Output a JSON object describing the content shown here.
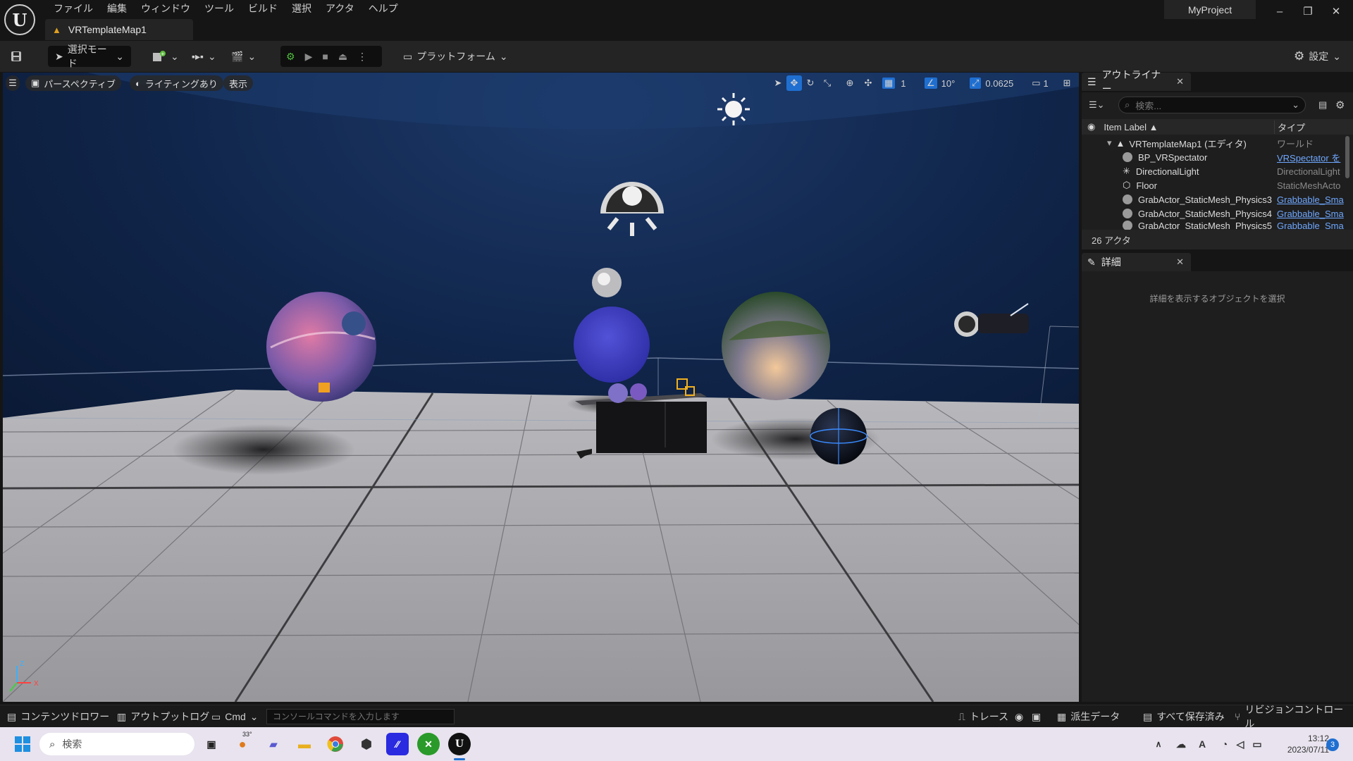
{
  "menu": [
    "ファイル",
    "編集",
    "ウィンドウ",
    "ツール",
    "ビルド",
    "選択",
    "アクタ",
    "ヘルプ"
  ],
  "map_tab": "VRTemplateMap1",
  "project_name": "MyProject",
  "toolbar": {
    "select_mode": "選択モード",
    "platform": "プラットフォーム",
    "settings": "設定"
  },
  "viewport": {
    "perspective": "パースペクティブ",
    "lighting": "ライティングあり",
    "show": "表示",
    "grid_size": "1",
    "rotation_snap": "10°",
    "scale_snap": "0.0625",
    "camera_speed": "1"
  },
  "outliner": {
    "tab_label": "アウトライナー",
    "search_placeholder": "検索...",
    "col_label": "Item Label ▲",
    "col_type": "タイプ",
    "rows": [
      {
        "label": "VRTemplateMap1 (エディタ)",
        "type": "ワールド"
      },
      {
        "label": "BP_VRSpectator",
        "type": "VRSpectator を"
      },
      {
        "label": "DirectionalLight",
        "type": "DirectionalLight"
      },
      {
        "label": "Floor",
        "type": "StaticMeshActo"
      },
      {
        "label": "GrabActor_StaticMesh_Physics3",
        "type": "Grabbable_Sma"
      },
      {
        "label": "GrabActor_StaticMesh_Physics4",
        "type": "Grabbable_Sma"
      },
      {
        "label": "GrabActor_StaticMesh_Physics5",
        "type": "Grabbable_Sma"
      }
    ],
    "actor_count": "26 アクタ"
  },
  "details": {
    "tab_label": "詳細",
    "empty_message": "詳細を表示するオブジェクトを選択"
  },
  "bottom": {
    "content_drawer": "コンテンツドロワー",
    "output_log": "アウトプットログ",
    "cmd": "Cmd",
    "console_placeholder": "コンソールコマンドを入力します",
    "trace": "トレース",
    "derived_data": "派生データ",
    "save_all": "すべて保存済み",
    "revision_control": "リビジョンコントロール"
  },
  "taskbar": {
    "search": "検索",
    "weather": "33°",
    "ime": "A",
    "time": "13:12",
    "date": "2023/07/11",
    "notifications": "3"
  },
  "colors": {
    "accent": "#1f6fd1",
    "link": "#6fa8ff",
    "panel": "#1e1e1e",
    "toolbar": "#242424"
  }
}
